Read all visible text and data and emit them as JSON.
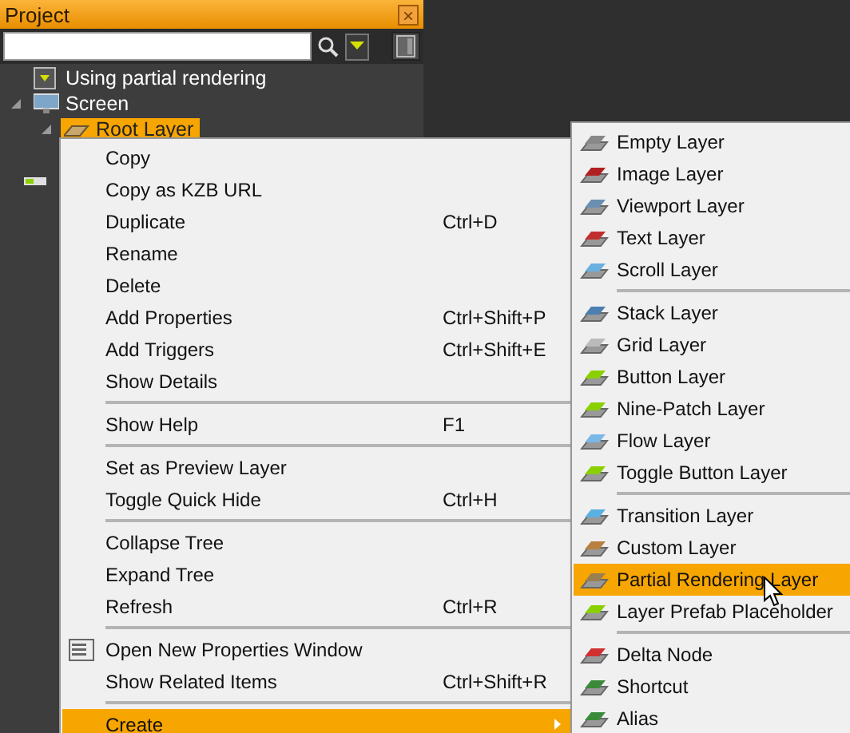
{
  "panel": {
    "title": "Project",
    "close": "×"
  },
  "tree": [
    {
      "kind": "setting",
      "label": "Using partial rendering",
      "selected": false
    },
    {
      "kind": "screen",
      "label": "Screen",
      "selected": false,
      "expanded": true,
      "children": [
        {
          "kind": "layer",
          "label": "Root Layer",
          "selected": true,
          "expanded": true
        }
      ]
    }
  ],
  "context_menu": [
    {
      "kind": "item",
      "label": "Copy",
      "selected": false
    },
    {
      "kind": "item",
      "label": "Copy as KZB URL",
      "selected": false
    },
    {
      "kind": "item",
      "label": "Duplicate",
      "shortcut": "Ctrl+D",
      "selected": false
    },
    {
      "kind": "item",
      "label": "Rename",
      "selected": false
    },
    {
      "kind": "item",
      "label": "Delete",
      "selected": false
    },
    {
      "kind": "item",
      "label": "Add Properties",
      "shortcut": "Ctrl+Shift+P",
      "selected": false
    },
    {
      "kind": "item",
      "label": "Add Triggers",
      "shortcut": "Ctrl+Shift+E",
      "selected": false
    },
    {
      "kind": "item",
      "label": "Show Details",
      "selected": false
    },
    {
      "kind": "separator"
    },
    {
      "kind": "item",
      "label": "Show Help",
      "shortcut": "F1",
      "selected": false
    },
    {
      "kind": "separator"
    },
    {
      "kind": "item",
      "label": "Set as Preview Layer",
      "selected": false
    },
    {
      "kind": "item",
      "label": "Toggle Quick Hide",
      "shortcut": "Ctrl+H",
      "selected": false
    },
    {
      "kind": "separator"
    },
    {
      "kind": "item",
      "label": "Collapse Tree",
      "selected": false
    },
    {
      "kind": "item",
      "label": "Expand Tree",
      "selected": false
    },
    {
      "kind": "item",
      "label": "Refresh",
      "shortcut": "Ctrl+R",
      "selected": false
    },
    {
      "kind": "separator"
    },
    {
      "kind": "item",
      "label": "Open New Properties Window",
      "icon": true,
      "selected": false
    },
    {
      "kind": "item",
      "label": "Show Related Items",
      "shortcut": "Ctrl+Shift+R",
      "selected": false
    },
    {
      "kind": "separator"
    },
    {
      "kind": "item",
      "label": "Create",
      "submenu": true,
      "selected": true
    }
  ],
  "submenu": [
    {
      "kind": "item",
      "label": "Empty Layer",
      "selected": false
    },
    {
      "kind": "item",
      "label": "Image Layer",
      "selected": false
    },
    {
      "kind": "item",
      "label": "Viewport Layer",
      "selected": false
    },
    {
      "kind": "item",
      "label": "Text Layer",
      "selected": false
    },
    {
      "kind": "item",
      "label": "Scroll Layer",
      "selected": false
    },
    {
      "kind": "separator"
    },
    {
      "kind": "item",
      "label": "Stack Layer",
      "selected": false
    },
    {
      "kind": "item",
      "label": "Grid Layer",
      "selected": false
    },
    {
      "kind": "item",
      "label": "Button Layer",
      "selected": false
    },
    {
      "kind": "item",
      "label": "Nine-Patch Layer",
      "selected": false
    },
    {
      "kind": "item",
      "label": "Flow Layer",
      "selected": false
    },
    {
      "kind": "item",
      "label": "Toggle Button Layer",
      "selected": false
    },
    {
      "kind": "separator"
    },
    {
      "kind": "item",
      "label": "Transition Layer",
      "selected": false
    },
    {
      "kind": "item",
      "label": "Custom Layer",
      "selected": false
    },
    {
      "kind": "item",
      "label": "Partial Rendering Layer",
      "selected": true
    },
    {
      "kind": "item",
      "label": "Layer Prefab Placeholder",
      "selected": false
    },
    {
      "kind": "separator"
    },
    {
      "kind": "item",
      "label": "Delta Node",
      "selected": false
    },
    {
      "kind": "item",
      "label": "Shortcut",
      "selected": false
    },
    {
      "kind": "item",
      "label": "Alias",
      "selected": false
    }
  ]
}
